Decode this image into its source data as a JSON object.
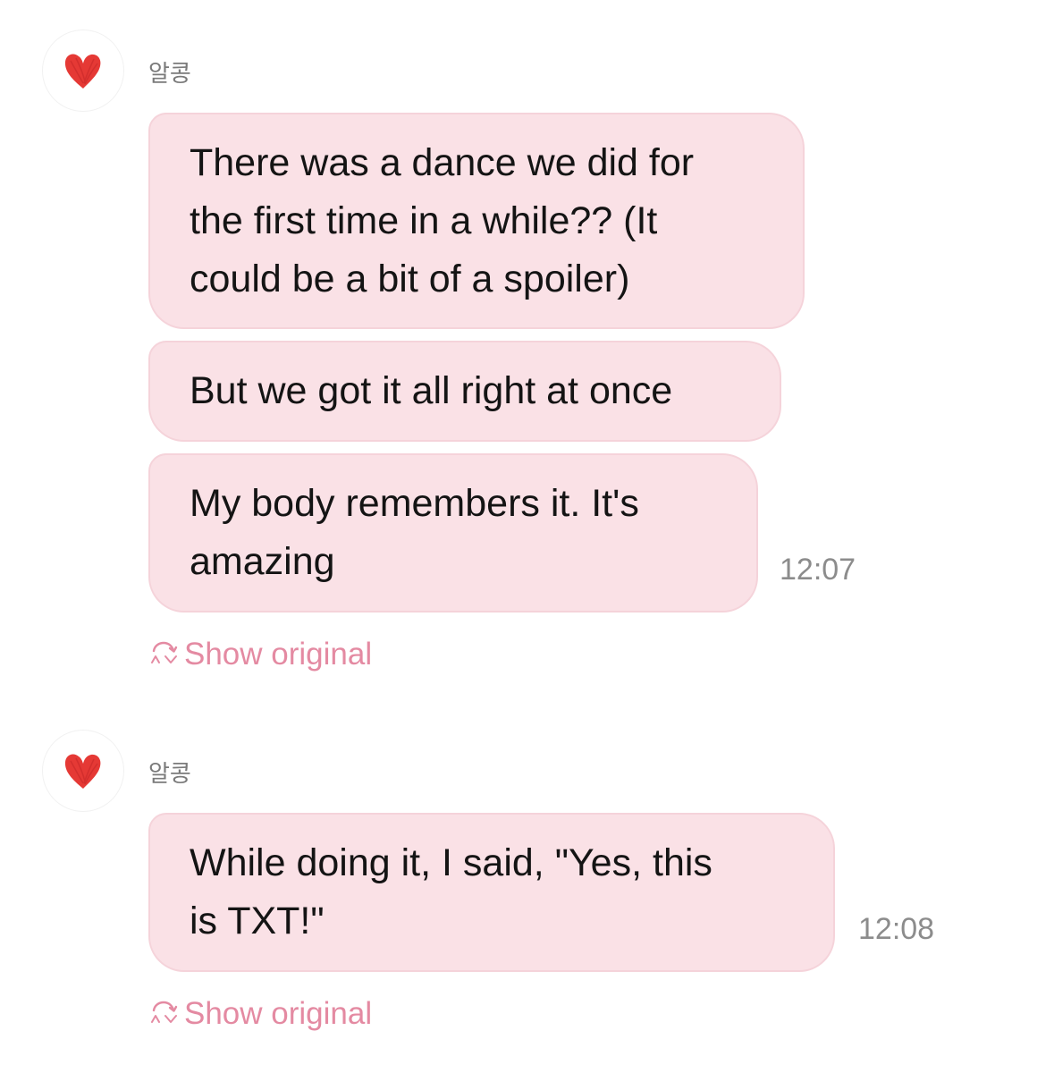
{
  "colors": {
    "bubble_bg": "#fae1e6",
    "accent_pink": "#e48aa2",
    "heart_red": "#e53935",
    "timestamp_gray": "#8c8c8c"
  },
  "groups": [
    {
      "sender": "알콩",
      "avatar_icon": "red-heart-icon",
      "messages": [
        {
          "text": "There was a dance we did for\nthe first time in a while?? (It\ncould be a bit of a spoiler)"
        },
        {
          "text": "But we got it all right at once"
        },
        {
          "text": "My body remembers it. It's\namazing",
          "time": "12:07"
        }
      ],
      "show_original": "Show original"
    },
    {
      "sender": "알콩",
      "avatar_icon": "red-heart-icon",
      "messages": [
        {
          "text": "While doing it, I said, \"Yes, this\nis TXT!\"",
          "time": "12:08"
        }
      ],
      "show_original": "Show original"
    }
  ]
}
